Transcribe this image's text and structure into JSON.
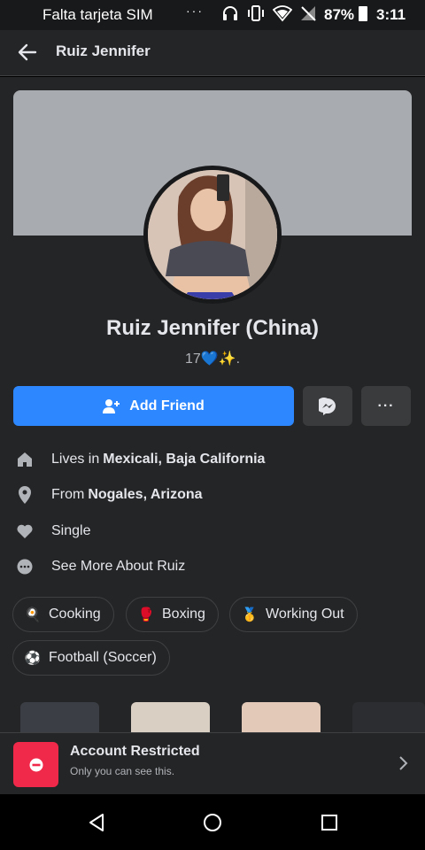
{
  "status_bar": {
    "carrier": "Falta tarjeta SIM",
    "dots": "···",
    "battery_pct": "87%",
    "time": "3:11"
  },
  "header": {
    "title": "Ruiz Jennifer",
    "back_icon": "arrow-left-icon"
  },
  "profile": {
    "name": "Ruiz Jennifer (China)",
    "bio": "17💙✨."
  },
  "actions": {
    "add_friend_label": "Add Friend",
    "more_label": "···",
    "accent": "#2d88ff"
  },
  "details": [
    {
      "icon": "home-icon",
      "prefix": "Lives in",
      "value": "Mexicali, Baja California"
    },
    {
      "icon": "location-pin-icon",
      "prefix": "From",
      "value": "Nogales, Arizona"
    },
    {
      "icon": "heart-icon",
      "prefix": "Single",
      "value": ""
    },
    {
      "icon": "more-dots-icon",
      "prefix": "See More About Ruiz",
      "value": ""
    }
  ],
  "hobbies": [
    {
      "emoji": "🍳",
      "label": "Cooking"
    },
    {
      "emoji": "🥊",
      "label": "Boxing"
    },
    {
      "emoji": "🥇",
      "label": "Working Out"
    },
    {
      "emoji": "⚽",
      "label": "Football (Soccer)"
    }
  ],
  "banner": {
    "title": "Account Restricted",
    "subtitle": "Only you can see this.",
    "color": "#f02849"
  },
  "nav": [
    "back-triangle-icon",
    "home-circle-icon",
    "recents-square-icon"
  ]
}
